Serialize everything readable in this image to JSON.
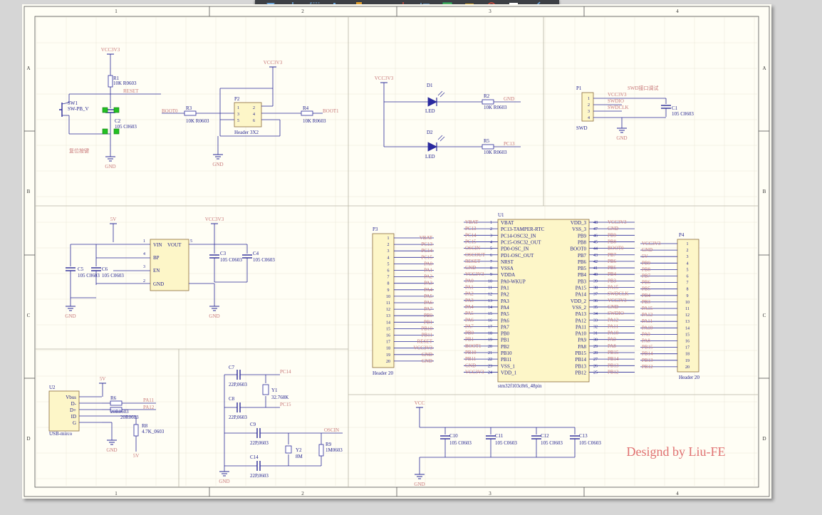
{
  "frame": {
    "columns": [
      "1",
      "2",
      "3",
      "4"
    ],
    "rows": [
      "A",
      "B",
      "C",
      "D"
    ]
  },
  "toolbar": {
    "tools": [
      {
        "icon": "filter-icon"
      },
      {
        "icon": "crosshair-icon"
      },
      {
        "icon": "select-rect-icon"
      },
      {
        "icon": "align-icon"
      },
      {
        "icon": "component-icon"
      },
      {
        "icon": "wire-icon"
      },
      {
        "icon": "ground-power-icon"
      },
      {
        "icon": "bus-icon"
      },
      {
        "icon": "sheet-symbol-icon"
      },
      {
        "icon": "part-icon"
      },
      {
        "icon": "probe-icon"
      },
      {
        "icon": "text-frame-icon"
      },
      {
        "icon": "line-icon"
      }
    ]
  },
  "colors": {
    "wire": "#2a2a99",
    "body": "#fdf6c8",
    "designator": "#1e1e8c",
    "net": "#c87878",
    "grid": "#e9e6d6",
    "accent": "#e07070"
  },
  "schematic": {
    "nets": {
      "vcc3v3": "VCC3V3",
      "gnd": "GND",
      "reset": "RESET",
      "boot0": "BOOT0",
      "boot1": "BOOT1",
      "v5": "5V",
      "vcc": "VCC",
      "pa11": "PA11",
      "pa12": "PA12",
      "pc14": "PC14",
      "pc15": "PC15",
      "oscin": "OSCIN",
      "pc13": "PC13",
      "swdio": "SWDIO",
      "swclk": "SWDCLK",
      "swd_hint": "SWD接口调试"
    },
    "sw1": {
      "ref": "SW1",
      "type": "SW-PB_V",
      "note": "复位按键"
    },
    "r1": {
      "ref": "R1",
      "val": "10K R0603"
    },
    "c2": {
      "ref": "C2",
      "val": "105 C0603"
    },
    "r3": {
      "ref": "R3",
      "val": "10K R0603"
    },
    "r4": {
      "ref": "R4",
      "val": "10K R0603"
    },
    "p2": {
      "ref": "P2",
      "type": "Header 3X2",
      "pins": [
        "1",
        "2",
        "3",
        "4",
        "5",
        "6"
      ]
    },
    "d1": {
      "ref": "D1",
      "type": "LED"
    },
    "d2": {
      "ref": "D2",
      "type": "LED"
    },
    "r2": {
      "ref": "R2",
      "val": "10K R0603"
    },
    "r5": {
      "ref": "R5",
      "val": "10K R0603"
    },
    "p1": {
      "ref": "P1",
      "type": "SWD",
      "pins": [
        "1",
        "2",
        "3",
        "4"
      ]
    },
    "c1": {
      "ref": "C1",
      "val": "105 C0603"
    },
    "ldo": {
      "vin": "VIN",
      "vout": "VOUT",
      "bp": "BP",
      "en": "EN",
      "gnd": "GND",
      "pins": [
        "1",
        "5",
        "4",
        "3",
        "2"
      ]
    },
    "c5": {
      "ref": "C5",
      "val": "105 C0603"
    },
    "c6": {
      "ref": "C6",
      "val": "105 C0603"
    },
    "c3": {
      "ref": "C3",
      "val": "105 C0603"
    },
    "c4": {
      "ref": "C4",
      "val": "105 C0603"
    },
    "u2": {
      "ref": "U2",
      "type": "USB-mirco",
      "pins": [
        "Vbus",
        "D-",
        "D+",
        "ID",
        "G"
      ]
    },
    "r6": {
      "ref": "R6",
      "val": "20R0603"
    },
    "r7": {
      "ref": "R7",
      "val": "20R0603"
    },
    "r8": {
      "ref": "R8",
      "val": "4.7K_0603"
    },
    "c7": {
      "ref": "C7",
      "val": "22P,0603"
    },
    "c8": {
      "ref": "C8",
      "val": "22P,0603"
    },
    "c9": {
      "ref": "C9",
      "val": "22P,0603"
    },
    "c14": {
      "ref": "C14",
      "val": "22P,0603"
    },
    "y1": {
      "ref": "Y1",
      "val": "32.768K"
    },
    "y2": {
      "ref": "Y2",
      "val": "8M"
    },
    "r9": {
      "ref": "R9",
      "val": "1M0603"
    },
    "p3": {
      "ref": "P3",
      "type": "Header 20",
      "nets": [
        "VBAT",
        "PC13",
        "PC14",
        "PC15",
        "PA0",
        "PA1",
        "PA2",
        "PA3",
        "PA4",
        "PA5",
        "PA6",
        "PA7",
        "PB0",
        "PB1",
        "PB10",
        "PB11",
        "RESET",
        "VCC3V3",
        "GND",
        "GND"
      ]
    },
    "p4": {
      "ref": "P4",
      "type": "Header 20",
      "nets": [
        "VCC3V3",
        "GND",
        "5V",
        "PB9",
        "PB8",
        "PB7",
        "PB6",
        "PB5",
        "PB4",
        "PB3",
        "PA15",
        "PA12",
        "PA11",
        "PA10",
        "PA9",
        "PA8",
        "PB15",
        "PB14",
        "PB13",
        "PB12"
      ]
    },
    "u1": {
      "ref": "U1",
      "type": "stm32f103c8t6_48pin",
      "left": [
        {
          "net": "VBAT",
          "num": "1",
          "name": "VBAT"
        },
        {
          "net": "PC13",
          "num": "2",
          "name": "PC13-TAMPER-RTC"
        },
        {
          "net": "PC14",
          "num": "3",
          "name": "PC14-OSC32_IN"
        },
        {
          "net": "PC15",
          "num": "4",
          "name": "PC15-OSC32_OUT"
        },
        {
          "net": "OSCIN",
          "num": "5",
          "name": "PD0-OSC_IN"
        },
        {
          "net": "OSCOUT",
          "num": "6",
          "name": "PD1-OSC_OUT"
        },
        {
          "net": "RESET",
          "num": "7",
          "name": "NRST"
        },
        {
          "net": "GND",
          "num": "8",
          "name": "VSSA"
        },
        {
          "net": "VCC3V3",
          "num": "9",
          "name": "VDDA"
        },
        {
          "net": "PA0",
          "num": "10",
          "name": "PA0-WKUP"
        },
        {
          "net": "PA1",
          "num": "11",
          "name": "PA1"
        },
        {
          "net": "PA2",
          "num": "12",
          "name": "PA2"
        },
        {
          "net": "PA3",
          "num": "13",
          "name": "PA3"
        },
        {
          "net": "PA4",
          "num": "14",
          "name": "PA4"
        },
        {
          "net": "PA5",
          "num": "15",
          "name": "PA5"
        },
        {
          "net": "PA6",
          "num": "16",
          "name": "PA6"
        },
        {
          "net": "PA7",
          "num": "17",
          "name": "PA7"
        },
        {
          "net": "PB0",
          "num": "18",
          "name": "PB0"
        },
        {
          "net": "PB1",
          "num": "19",
          "name": "PB1"
        },
        {
          "net": "BOOT1",
          "num": "20",
          "name": "PB2"
        },
        {
          "net": "PB10",
          "num": "21",
          "name": "PB10"
        },
        {
          "net": "PB11",
          "num": "22",
          "name": "PB11"
        },
        {
          "net": "GND",
          "num": "23",
          "name": "VSS_1"
        },
        {
          "net": "VCC3V3",
          "num": "24",
          "name": "VDD_1"
        }
      ],
      "right": [
        {
          "net": "VCC3V3",
          "num": "48",
          "name": "VDD_3"
        },
        {
          "net": "GND",
          "num": "47",
          "name": "VSS_3"
        },
        {
          "net": "PB9",
          "num": "46",
          "name": "PB9"
        },
        {
          "net": "PB8",
          "num": "45",
          "name": "PB8"
        },
        {
          "net": "BOOT0",
          "num": "44",
          "name": "BOOT0"
        },
        {
          "net": "PB7",
          "num": "43",
          "name": "PB7"
        },
        {
          "net": "PB6",
          "num": "42",
          "name": "PB6"
        },
        {
          "net": "PB5",
          "num": "41",
          "name": "PB5"
        },
        {
          "net": "PB4",
          "num": "40",
          "name": "PB4"
        },
        {
          "net": "PB3",
          "num": "39",
          "name": "PB3"
        },
        {
          "net": "PA15",
          "num": "38",
          "name": "PA15"
        },
        {
          "net": "SWDCLK",
          "num": "37",
          "name": "PA14"
        },
        {
          "net": "VCC3V3",
          "num": "36",
          "name": "VDD_2"
        },
        {
          "net": "GND",
          "num": "35",
          "name": "VSS_2"
        },
        {
          "net": "SWDIO",
          "num": "34",
          "name": "PA13"
        },
        {
          "net": "PA12",
          "num": "33",
          "name": "PA12"
        },
        {
          "net": "PA11",
          "num": "32",
          "name": "PA11"
        },
        {
          "net": "PA10",
          "num": "31",
          "name": "PA10"
        },
        {
          "net": "PA9",
          "num": "30",
          "name": "PA9"
        },
        {
          "net": "PA8",
          "num": "29",
          "name": "PA8"
        },
        {
          "net": "PB15",
          "num": "28",
          "name": "PB15"
        },
        {
          "net": "PB14",
          "num": "27",
          "name": "PB14"
        },
        {
          "net": "PB13",
          "num": "26",
          "name": "PB13"
        },
        {
          "net": "PB12",
          "num": "25",
          "name": "PB12"
        }
      ]
    },
    "c10": {
      "ref": "C10",
      "val": "105 C0603"
    },
    "c11": {
      "ref": "C11",
      "val": "105 C0603"
    },
    "c12": {
      "ref": "C12",
      "val": "105 C0603"
    },
    "c13": {
      "ref": "C13",
      "val": "105 C0603"
    },
    "signature": "Designd by Liu-FE"
  }
}
